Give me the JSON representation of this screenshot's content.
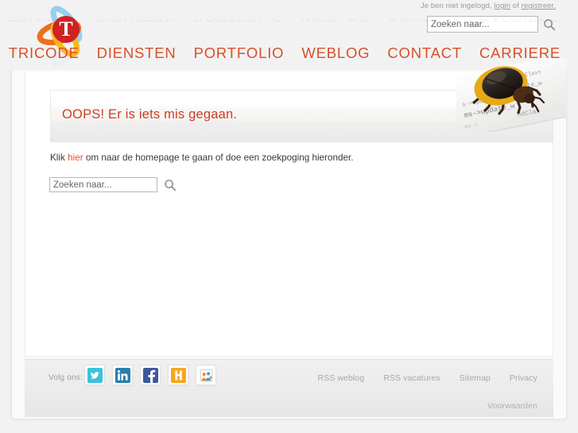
{
  "header": {
    "login_notice_prefix": "Je ben niet ingelogd, ",
    "login_link": "login",
    "login_notice_mid": " of ",
    "register_link": "registreer.",
    "search_placeholder": "Zoeken naar...",
    "search_value": "",
    "search_icon": "search-icon",
    "logo_letter": "T",
    "logo_colors": {
      "circle": "#cf2222",
      "swoosh_orange": "#ee6611",
      "swoosh_blue": "#8ecdf0",
      "swoosh_yellow": "#f9b515"
    }
  },
  "nav": {
    "accent_color": "#d94f2b",
    "items": [
      {
        "label": "TRICODE"
      },
      {
        "label": "DIENSTEN"
      },
      {
        "label": "PORTFOLIO"
      },
      {
        "label": "WEBLOG"
      },
      {
        "label": "CONTACT"
      },
      {
        "label": "CARRIERE"
      }
    ]
  },
  "main": {
    "error_heading": "OOPS! Er is iets mis gegaan.",
    "error_heading_color": "#cc3f26",
    "help_prefix": "Klik ",
    "help_link": "hier",
    "help_suffix": " om naar de homepage te gaan of doe een zoekpoging hieronder.",
    "search_placeholder": "Zoeken naar...",
    "search_value": "",
    "search_icon": "search-icon",
    "beetle_image_alt": "bug-on-code-printout",
    "beetle_code_text": "ms->update_w"
  },
  "footer": {
    "follow_label": "Volg ons:",
    "social": [
      {
        "name": "twitter-icon",
        "title": "Twitter",
        "color": "#3bc1dd"
      },
      {
        "name": "linkedin-icon",
        "title": "LinkedIn",
        "color": "#2a7ead"
      },
      {
        "name": "facebook-icon",
        "title": "Facebook",
        "color": "#3b5998"
      },
      {
        "name": "hyves-icon",
        "title": "Hyves",
        "color": "#f5a623"
      },
      {
        "name": "community-icon",
        "title": "Community",
        "color": "#f58220"
      }
    ],
    "links": [
      {
        "label": "RSS weblog"
      },
      {
        "label": "RSS vacatures"
      },
      {
        "label": "Sitemap"
      },
      {
        "label": "Privacy"
      }
    ],
    "terms_label": "Voorwaarden"
  }
}
